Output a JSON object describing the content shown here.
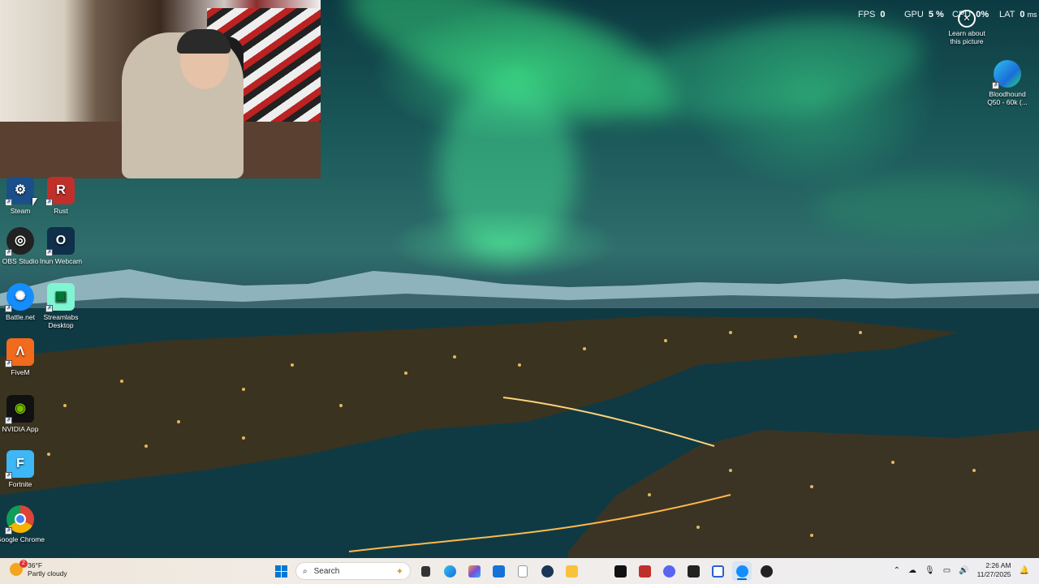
{
  "overlay": {
    "fps_label": "FPS",
    "fps_value": "0",
    "gpu_label": "GPU",
    "gpu_value": "5",
    "gpu_unit": "%",
    "cpu_label": "CPU",
    "cpu_value": "0",
    "cpu_unit": "%",
    "lat_label": "LAT",
    "lat_value": "0",
    "lat_unit": "ms"
  },
  "wallpaper": {
    "learn_label": "Learn about this picture"
  },
  "desktop_icons": {
    "steam": "Steam",
    "rust": "Rust",
    "obs": "OBS Studio",
    "inun": "Inun Webcam",
    "battlenet": "Battle.net",
    "streamlabs": "Streamlabs Desktop",
    "fivem": "FiveM",
    "nvidia": "NVIDIA App",
    "fortnite": "Fortnite",
    "chrome": "Google Chrome",
    "bloodhound": "Bloodhound Q50 - 60k (..."
  },
  "taskbar": {
    "weather_temp": "36°F",
    "weather_desc": "Partly cloudy",
    "weather_badge": "2",
    "search_placeholder": "Search",
    "time": "2:26 AM",
    "date": "11/27/2025"
  },
  "colors": {
    "taskbar_bg": "#f1ece6",
    "accent": "#0067c0"
  }
}
